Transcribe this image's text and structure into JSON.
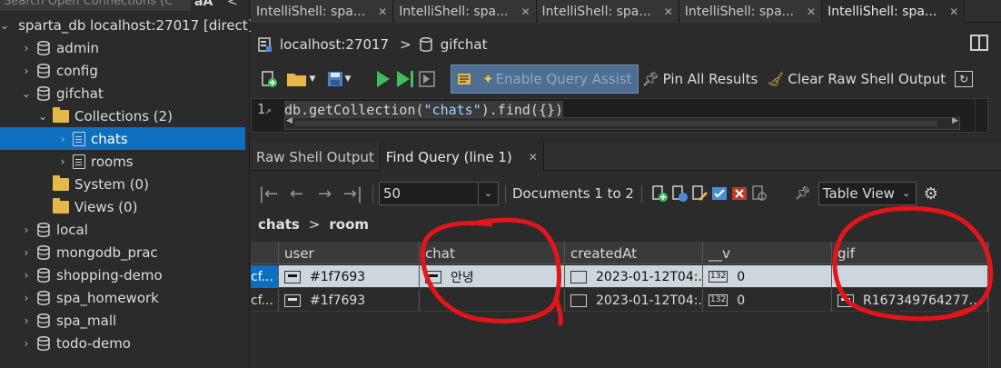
{
  "left": {
    "search_placeholder": "Search Open Connections (C",
    "aa_label": "aA",
    "tree": [
      {
        "label": "sparta_db localhost:27017 [direct]",
        "depth": 0,
        "icon": "db-icon",
        "chevron": "down"
      },
      {
        "label": "admin",
        "depth": 1,
        "icon": "db-icon",
        "chevron": "right"
      },
      {
        "label": "config",
        "depth": 1,
        "icon": "db-icon",
        "chevron": "right"
      },
      {
        "label": "gifchat",
        "depth": 1,
        "icon": "db-icon",
        "chevron": "down"
      },
      {
        "label": "Collections (2)",
        "depth": 2,
        "icon": "folder-icon",
        "chevron": "down"
      },
      {
        "label": "chats",
        "depth": 3,
        "icon": "collection-icon",
        "chevron": "right",
        "selected": true
      },
      {
        "label": "rooms",
        "depth": 3,
        "icon": "collection-icon",
        "chevron": "right"
      },
      {
        "label": "System (0)",
        "depth": 2,
        "icon": "folder-icon",
        "chevron": "none"
      },
      {
        "label": "Views (0)",
        "depth": 2,
        "icon": "folder-icon",
        "chevron": "none"
      },
      {
        "label": "local",
        "depth": 1,
        "icon": "db-icon",
        "chevron": "right"
      },
      {
        "label": "mongodb_prac",
        "depth": 1,
        "icon": "db-icon",
        "chevron": "right"
      },
      {
        "label": "shopping-demo",
        "depth": 1,
        "icon": "db-icon",
        "chevron": "right"
      },
      {
        "label": "spa_homework",
        "depth": 1,
        "icon": "db-icon",
        "chevron": "right"
      },
      {
        "label": "spa_mall",
        "depth": 1,
        "icon": "db-icon",
        "chevron": "right"
      },
      {
        "label": "todo-demo",
        "depth": 1,
        "icon": "db-icon",
        "chevron": "right"
      }
    ]
  },
  "tabs": [
    {
      "label": "IntelliShell: spa...",
      "active": false
    },
    {
      "label": "IntelliShell: spa...",
      "active": false
    },
    {
      "label": "IntelliShell: spa...",
      "active": false
    },
    {
      "label": "IntelliShell: spa...",
      "active": false
    },
    {
      "label": "IntelliShell: spa...",
      "active": true
    }
  ],
  "breadcrumb": {
    "connection": "localhost:27017",
    "separator": ">",
    "database": "gifchat"
  },
  "toolbar": {
    "assist_label": "Enable Query Assist",
    "pin_label": "Pin All Results",
    "clear_label": "Clear Raw Shell Output"
  },
  "editor": {
    "line_number": "1",
    "code_prefix": "db.getCollection(",
    "code_string": "\"chats\"",
    "code_suffix": ").find({})"
  },
  "result_tabs": [
    {
      "label": "Raw Shell Output",
      "active": false,
      "closable": false
    },
    {
      "label": "Find Query (line 1)",
      "active": true,
      "closable": true
    }
  ],
  "results_toolbar": {
    "page_size": "50",
    "documents_label": "Documents 1 to 2",
    "view_mode": "Table View"
  },
  "result_path": {
    "collection": "chats",
    "separator": ">",
    "field": "room"
  },
  "table": {
    "columns": [
      "",
      "user",
      "chat",
      "createdAt",
      "__v",
      "gif"
    ],
    "rows": [
      {
        "id": "cf...",
        "user": "#1f7693",
        "chat": "안녕",
        "createdAt": "2023-01-12T04:...",
        "v": "0",
        "gif": "",
        "selected": true
      },
      {
        "id": "cf...",
        "user": "#1f7693",
        "chat": "",
        "createdAt": "2023-01-12T04:...",
        "v": "0",
        "gif": "R167349764277...",
        "selected": false
      }
    ]
  },
  "colors": {
    "selection": "#0e6fc1",
    "annotation": "#e3151a",
    "string": "#9ad5ff",
    "run_green": "#3fbf5a"
  }
}
